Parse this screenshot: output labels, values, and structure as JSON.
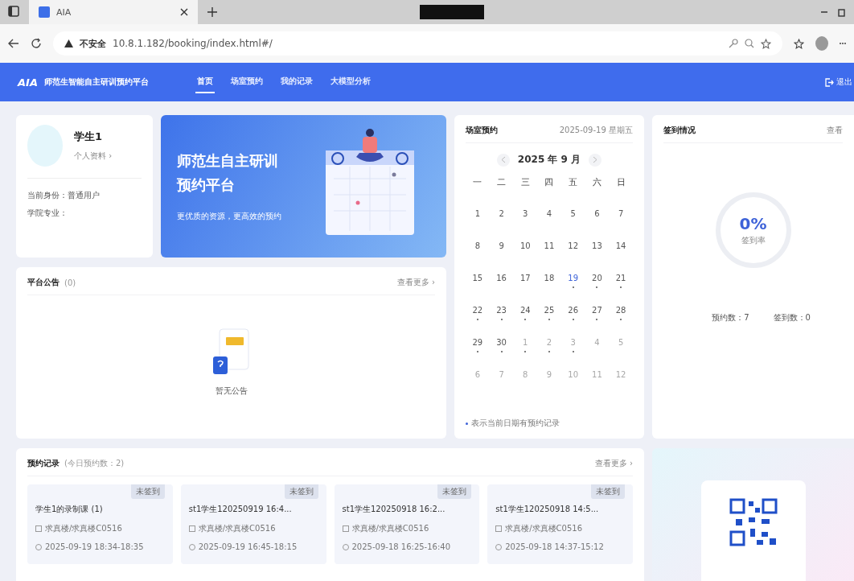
{
  "browser": {
    "tab_title": "AIA",
    "security": "不安全",
    "url": "10.8.1.182/booking/index.html#/"
  },
  "header": {
    "logo": "AIA",
    "title": "师范生智能自主研训预约平台",
    "logout": "退出"
  },
  "nav": [
    {
      "label": "首页",
      "selected": true
    },
    {
      "label": "场室预约",
      "selected": false
    },
    {
      "label": "我的记录",
      "selected": false
    },
    {
      "label": "大模型分析",
      "selected": false
    }
  ],
  "profile": {
    "name": "学生1",
    "link": "个人资料 ›",
    "role": "当前身份：普通用户",
    "major": "学院专业："
  },
  "banner": {
    "title_line1": "师范生自主研训",
    "title_line2": "预约平台",
    "subtitle": "更优质的资源，更高效的预约"
  },
  "notices": {
    "title": "平台公告",
    "count": "(0)",
    "more": "查看更多 ›",
    "empty": "暂无公告"
  },
  "calendar": {
    "title": "场室预约",
    "date": "2025-09-19 星期五",
    "month": "2025 年 9 月",
    "weekdays": [
      "一",
      "二",
      "三",
      "四",
      "五",
      "六",
      "日"
    ],
    "days": [
      {
        "day": "1",
        "other_month": false,
        "today": false,
        "has_booking": false
      },
      {
        "day": "2",
        "other_month": false,
        "today": false,
        "has_booking": false
      },
      {
        "day": "3",
        "other_month": false,
        "today": false,
        "has_booking": false
      },
      {
        "day": "4",
        "other_month": false,
        "today": false,
        "has_booking": false
      },
      {
        "day": "5",
        "other_month": false,
        "today": false,
        "has_booking": false
      },
      {
        "day": "6",
        "other_month": false,
        "today": false,
        "has_booking": false
      },
      {
        "day": "7",
        "other_month": false,
        "today": false,
        "has_booking": false
      },
      {
        "day": "8",
        "other_month": false,
        "today": false,
        "has_booking": false
      },
      {
        "day": "9",
        "other_month": false,
        "today": false,
        "has_booking": false
      },
      {
        "day": "10",
        "other_month": false,
        "today": false,
        "has_booking": false
      },
      {
        "day": "11",
        "other_month": false,
        "today": false,
        "has_booking": false
      },
      {
        "day": "12",
        "other_month": false,
        "today": false,
        "has_booking": false
      },
      {
        "day": "13",
        "other_month": false,
        "today": false,
        "has_booking": false
      },
      {
        "day": "14",
        "other_month": false,
        "today": false,
        "has_booking": false
      },
      {
        "day": "15",
        "other_month": false,
        "today": false,
        "has_booking": false
      },
      {
        "day": "16",
        "other_month": false,
        "today": false,
        "has_booking": false
      },
      {
        "day": "17",
        "other_month": false,
        "today": false,
        "has_booking": false
      },
      {
        "day": "18",
        "other_month": false,
        "today": false,
        "has_booking": false
      },
      {
        "day": "19",
        "other_month": false,
        "today": true,
        "has_booking": true
      },
      {
        "day": "20",
        "other_month": false,
        "today": false,
        "has_booking": true
      },
      {
        "day": "21",
        "other_month": false,
        "today": false,
        "has_booking": true
      },
      {
        "day": "22",
        "other_month": false,
        "today": false,
        "has_booking": true
      },
      {
        "day": "23",
        "other_month": false,
        "today": false,
        "has_booking": true
      },
      {
        "day": "24",
        "other_month": false,
        "today": false,
        "has_booking": true
      },
      {
        "day": "25",
        "other_month": false,
        "today": false,
        "has_booking": true
      },
      {
        "day": "26",
        "other_month": false,
        "today": false,
        "has_booking": true
      },
      {
        "day": "27",
        "other_month": false,
        "today": false,
        "has_booking": true
      },
      {
        "day": "28",
        "other_month": false,
        "today": false,
        "has_booking": true
      },
      {
        "day": "29",
        "other_month": false,
        "today": false,
        "has_booking": true
      },
      {
        "day": "30",
        "other_month": false,
        "today": false,
        "has_booking": true
      },
      {
        "day": "1",
        "other_month": true,
        "today": false,
        "has_booking": true
      },
      {
        "day": "2",
        "other_month": true,
        "today": false,
        "has_booking": true
      },
      {
        "day": "3",
        "other_month": true,
        "today": false,
        "has_booking": true
      },
      {
        "day": "4",
        "other_month": true,
        "today": false,
        "has_booking": false
      },
      {
        "day": "5",
        "other_month": true,
        "today": false,
        "has_booking": false
      },
      {
        "day": "6",
        "other_month": true,
        "today": false,
        "has_booking": false
      },
      {
        "day": "7",
        "other_month": true,
        "today": false,
        "has_booking": false
      },
      {
        "day": "8",
        "other_month": true,
        "today": false,
        "has_booking": false
      },
      {
        "day": "9",
        "other_month": true,
        "today": false,
        "has_booking": false
      },
      {
        "day": "10",
        "other_month": true,
        "today": false,
        "has_booking": false
      },
      {
        "day": "11",
        "other_month": true,
        "today": false,
        "has_booking": false
      },
      {
        "day": "12",
        "other_month": true,
        "today": false,
        "has_booking": false
      }
    ],
    "legend": "表示当前日期有预约记录"
  },
  "checkin": {
    "title": "签到情况",
    "more": "查看",
    "rate": "0%",
    "rate_label": "签到率",
    "level": 0,
    "booked": "预约数：7",
    "signed": "签到数：0"
  },
  "records": {
    "title": "预约记录",
    "subtitle": "(今日预约数：2)",
    "more": "查看更多 ›",
    "items": [
      {
        "title": "学生1的录制课 (1)",
        "status": "未签到",
        "location": "求真楼/求真楼C0516",
        "time": "2025-09-19 18:34-18:35"
      },
      {
        "title": "st1学生120250919 16:4...",
        "status": "未签到",
        "location": "求真楼/求真楼C0516",
        "time": "2025-09-19 16:45-18:15"
      },
      {
        "title": "st1学生120250918 16:2...",
        "status": "未签到",
        "location": "求真楼/求真楼C0516",
        "time": "2025-09-18 16:25-16:40"
      },
      {
        "title": "st1学生120250918 14:5...",
        "status": "未签到",
        "location": "求真楼/求真楼C0516",
        "time": "2025-09-18 14:37-15:12"
      }
    ]
  }
}
